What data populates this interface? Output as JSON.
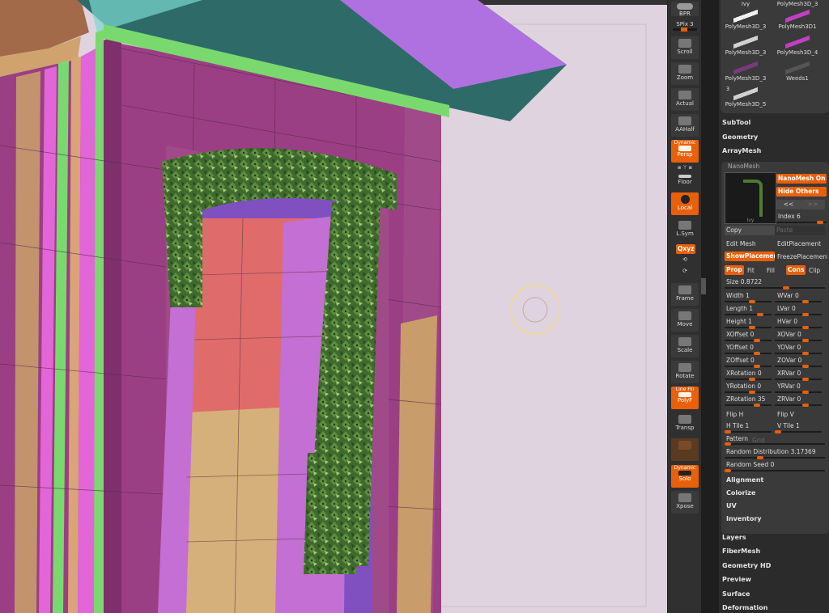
{
  "toolstrip": {
    "bpr": "BPR",
    "spix": "SPix 3",
    "scroll": "Scroll",
    "zoom": "Zoom",
    "actual": "Actual",
    "aahalf": "AAHalf",
    "dynamic": "Dynamic",
    "persp": "Persp",
    "floor": "Floor",
    "local": "Local",
    "lsym": "L.Sym",
    "xyz": "Qxyz",
    "frame": "Frame",
    "move": "Move",
    "scale": "Scale",
    "rotate": "Rotate",
    "linefill": "Line Fill",
    "polyf": "PolyF",
    "transp": "Transp",
    "ghost": "",
    "solo_top": "Dynamic",
    "solo": "Solo",
    "xpose": "Xpose"
  },
  "subtools": [
    {
      "label": "Ivy",
      "color": "#6a2a6a"
    },
    {
      "label": "PolyMesh3D_3",
      "color": "#c040c0"
    },
    {
      "label": "PolyMesh3D_3",
      "color": "#f0f0f0"
    },
    {
      "label": "PolyMesh3D1",
      "color": "#c040c0"
    },
    {
      "label": "PolyMesh3D_3",
      "color": "#d0d0d0"
    },
    {
      "label": "PolyMesh3D_4",
      "color": "#c040c0"
    },
    {
      "label": "PolyMesh3D_3",
      "color": "#7a3a7a"
    },
    {
      "label": "Weeds1",
      "color": "#555555"
    },
    {
      "label": "PolyMesh3D_5",
      "color": "#d0d0d0"
    }
  ],
  "thumb_extra": "3",
  "sections_top": [
    "SubTool",
    "Geometry",
    "ArrayMesh"
  ],
  "nanomesh": {
    "title": "NanoMesh",
    "thumb_label": "Ivy",
    "nanomesh_on": "NanoMesh On",
    "hide_others": "Hide Others",
    "prev": "<<",
    "next": ">>",
    "index": "Index 6",
    "copy": "Copy",
    "paste": "Paste",
    "edit_mesh": "Edit Mesh",
    "edit_placement": "EditPlacement",
    "show_placement": "ShowPlacement",
    "freeze_placement": "FreezePlacement",
    "prop": "Prop",
    "fit": "Fit",
    "fill": "Fill",
    "cons": "Cons",
    "clip": "Clip",
    "size": "Size 0.8722",
    "params": [
      [
        "Width 1",
        "WVar 0"
      ],
      [
        "Length 1",
        "LVar 0"
      ],
      [
        "Height 1",
        "HVar 0"
      ],
      [
        "XOffset 0",
        "XOVar 0"
      ],
      [
        "YOffset 0",
        "YOVar 0"
      ],
      [
        "ZOffset 0",
        "ZOVar 0"
      ],
      [
        "XRotation 0",
        "XRVar 0"
      ],
      [
        "YRotation 0",
        "YRVar 0"
      ],
      [
        "ZRotation 35",
        "ZRVar 0"
      ]
    ],
    "flip_h": "Flip H",
    "flip_v": "Flip V",
    "h_tile": "H Tile 1",
    "v_tile": "V Tile 1",
    "pattern": "Pattern",
    "grid": "Grid",
    "random_distribution": "Random Distribution 3.17369",
    "random_seed": "Random Seed 0",
    "subsections": [
      "Alignment",
      "Colorize",
      "UV",
      "Inventory"
    ]
  },
  "sections_bottom": [
    "Layers",
    "FiberMesh",
    "Geometry HD",
    "Preview",
    "Surface",
    "Deformation"
  ],
  "colors": {
    "accent": "#e8600a",
    "viewport_bg": "#dfd3df"
  }
}
